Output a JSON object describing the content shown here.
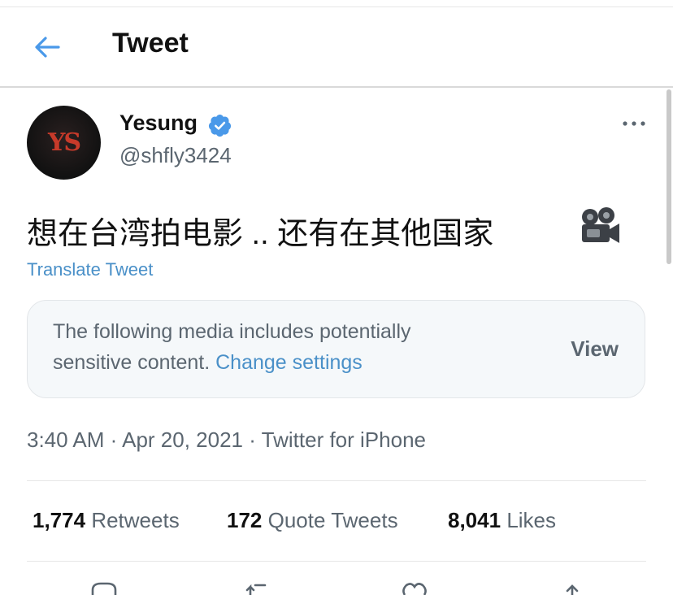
{
  "header": {
    "title": "Tweet"
  },
  "author": {
    "name": "Yesung",
    "handle": "@shfly3424",
    "avatar_text": "YS",
    "verified": true
  },
  "tweet": {
    "text": "想在台湾拍电影 .. 还有在其他国家",
    "emoji_icon": "movie-camera-icon",
    "translate_label": "Translate Tweet"
  },
  "sensitive_notice": {
    "line1": "The following media includes potentially",
    "line2_prefix": "sensitive content.",
    "change_settings": "Change settings",
    "view_label": "View"
  },
  "meta": {
    "time": "3:40 AM",
    "date": "Apr 20, 2021",
    "source": "Twitter for iPhone",
    "separator": "·"
  },
  "stats": {
    "retweets_count": "1,774",
    "retweets_label": "Retweets",
    "quotes_count": "172",
    "quotes_label": "Quote Tweets",
    "likes_count": "8,041",
    "likes_label": "Likes"
  },
  "colors": {
    "link": "#4a90c8",
    "verified": "#4a99e9",
    "muted": "#5b6670"
  }
}
